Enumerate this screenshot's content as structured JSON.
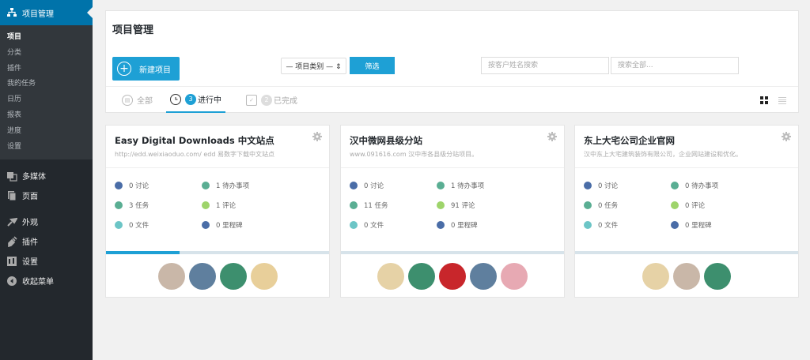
{
  "sidebar": {
    "top_label": "项目管理",
    "sub_items": [
      "项目",
      "分类",
      "插件",
      "我的任务",
      "日历",
      "报表",
      "进度",
      "设置"
    ],
    "items": [
      {
        "label": "多媒体",
        "icon": "media-icon"
      },
      {
        "label": "页面",
        "icon": "page-icon"
      },
      {
        "label": "外观",
        "icon": "appearance-icon"
      },
      {
        "label": "插件",
        "icon": "plugin-icon"
      },
      {
        "label": "设置",
        "icon": "settings-icon"
      },
      {
        "label": "收起菜单",
        "icon": "collapse-icon"
      }
    ]
  },
  "header": {
    "title": "项目管理",
    "new_button": "新建项目",
    "type_select": "— 项目类别 — ⇕",
    "filter_button": "筛选",
    "search_client_placeholder": "按客户姓名搜索",
    "search_all_placeholder": "搜索全部..."
  },
  "tabs": {
    "all": "全部",
    "in_progress_count": "3",
    "in_progress": "进行中",
    "done_count": "2",
    "done": "已完成"
  },
  "colors": {
    "accent": "#1ea0d5",
    "discussion": "#4a6da7",
    "todo": "#5aae93",
    "task": "#5aae93",
    "comment": "#9ed46b",
    "file": "#6cc5c6",
    "milestone": "#4a6da7"
  },
  "projects": [
    {
      "title": "Easy Digital Downloads 中文站点",
      "desc": "http://edd.weixiaoduo.com/ edd 易数字下载中文站点",
      "discussions": "0 讨论",
      "todos": "1 待办事项",
      "tasks": "3 任务",
      "comments": "1 评论",
      "files": "0 文件",
      "milestones": "0 里程碑",
      "progress": 0.33,
      "avatars": [
        "#c9b7a8",
        "#5f7f9e",
        "#3d8f6e",
        "#e8cf9a"
      ]
    },
    {
      "title": "汉中微网县级分站",
      "desc": "www.091616.com 汉中市各县级分站项目。",
      "discussions": "0 讨论",
      "todos": "1 待办事项",
      "tasks": "11 任务",
      "comments": "91 评论",
      "files": "0 文件",
      "milestones": "0 里程碑",
      "progress": 0,
      "avatars": [
        "#e6d2a6",
        "#3d8f6e",
        "#c8262b",
        "#5f7f9e",
        "#e7a9b3"
      ]
    },
    {
      "title": "东上大宅公司企业官网",
      "desc": "汉中东上大宅建筑装饰有限公司，企业网站建设和优化。",
      "discussions": "0 讨论",
      "todos": "0 待办事项",
      "tasks": "0 任务",
      "comments": "0 评论",
      "files": "0 文件",
      "milestones": "0 里程碑",
      "progress": 0,
      "avatars": [
        "#e6d2a6",
        "#c9b7a8",
        "#3d8f6e"
      ]
    }
  ]
}
